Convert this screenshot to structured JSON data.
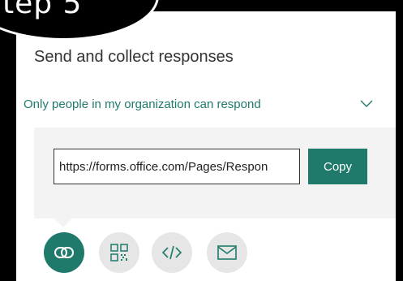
{
  "badge": {
    "text": "tep 5"
  },
  "panel": {
    "title": "Send and collect responses",
    "audience_dropdown": {
      "selected": "Only people in my organization can respond"
    },
    "link": {
      "url": "https://forms.office.com/Pages/Respon",
      "copy_label": "Copy"
    },
    "share_options": [
      {
        "icon": "link-icon",
        "active": true
      },
      {
        "icon": "qr-code-icon",
        "active": false
      },
      {
        "icon": "embed-code-icon",
        "active": false
      },
      {
        "icon": "email-icon",
        "active": false
      }
    ]
  },
  "colors": {
    "accent": "#1f7a6b",
    "link_area_bg": "#f3f3f3",
    "inactive_icon_bg": "#e6e6e6",
    "inactive_icon": "#1f7a6b"
  }
}
